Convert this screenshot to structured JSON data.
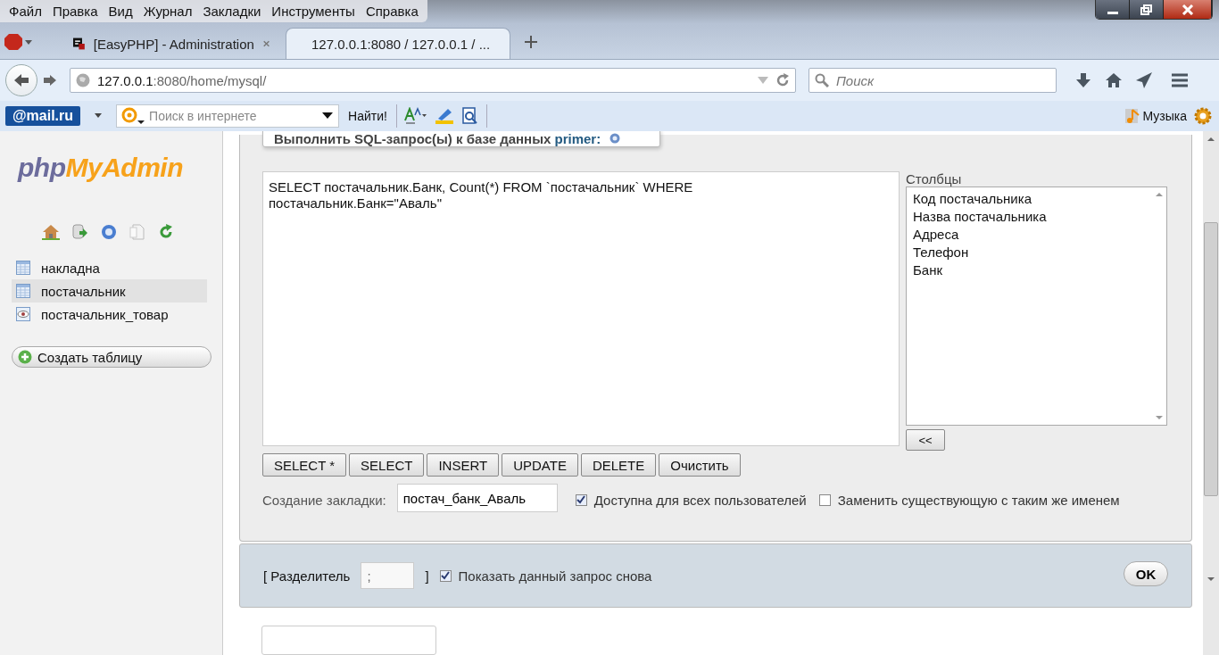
{
  "menu": [
    "Файл",
    "Правка",
    "Вид",
    "Журнал",
    "Закладки",
    "Инструменты",
    "Справка"
  ],
  "tabs": [
    {
      "title": "[EasyPHP] - Administration",
      "selected": false
    },
    {
      "title": "127.0.0.1:8080 / 127.0.0.1 / ...",
      "selected": true
    }
  ],
  "address": {
    "host": "127.0.0.1",
    "rest": ":8080/home/mysql/"
  },
  "search": {
    "placeholder": "Поиск"
  },
  "toolbar": {
    "brand": "@mail.ru",
    "search_placeholder": "Поиск в интернете",
    "find": "Найти!",
    "music": "Музыка"
  },
  "logo": [
    "php",
    "MyAdmin"
  ],
  "sidebar": {
    "items": [
      {
        "name": "накладна",
        "kind": "table",
        "selected": false
      },
      {
        "name": "постачальник",
        "kind": "table",
        "selected": true
      },
      {
        "name": "постачальник_товар",
        "kind": "view",
        "selected": false
      }
    ],
    "create": "Создать таблицу"
  },
  "query": {
    "legend": "Выполнить SQL-запрос(ы) к базе данных",
    "db": "primer:",
    "sql": "SELECT постачальник.Банк, Count(*) FROM `постачальник` WHERE\nпостачальник.Банк=\"Аваль\"",
    "columns_label": "Столбцы",
    "columns": [
      "Код постачальника",
      "Назва постачальника",
      "Адреса",
      "Телефон",
      "Банк"
    ],
    "insert": "<<",
    "buttons": [
      "SELECT *",
      "SELECT",
      "INSERT",
      "UPDATE",
      "DELETE",
      "Очистить"
    ],
    "bookmark_label": "Создание закладки:",
    "bookmark": "постач_банк_Аваль",
    "options": [
      {
        "label": "Доступна для всех пользователей",
        "checked": true
      },
      {
        "label": "Заменить существующую с таким же именем",
        "checked": false
      }
    ]
  },
  "footer": {
    "delimiter_label": "[ Разделитель",
    "delimiter": ";",
    "bracket": "]",
    "show_again": {
      "label": "Показать данный запрос снова",
      "checked": true
    },
    "ok": "OK"
  }
}
